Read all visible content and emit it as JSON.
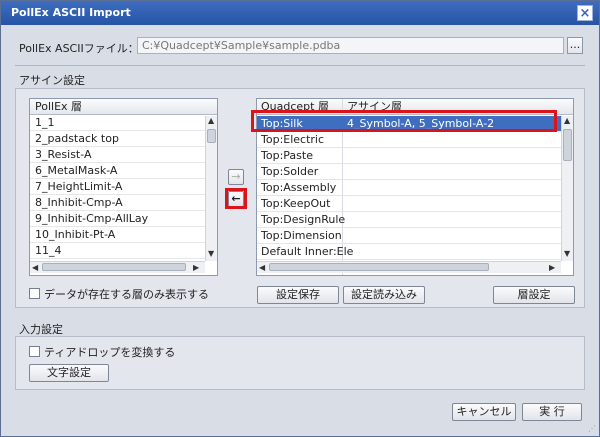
{
  "window": {
    "title": "PollEx ASCII Import"
  },
  "file": {
    "label": "PollEx ASCIIファイル：",
    "value": "C:¥Quadcept¥Sample¥sample.pdba",
    "browse": "..."
  },
  "assign": {
    "section_label": "アサイン設定",
    "pollex_header": "PollEx 層",
    "pollex_items": [
      "1_1",
      "2_padstack top",
      "3_Resist-A",
      "6_MetalMask-A",
      "7_HeightLimit-A",
      "8_Inhibit-Cmp-A",
      "9_Inhibit-Cmp-AllLay",
      "10_Inhibit-Pt-A",
      "11_4"
    ],
    "quadcept_header": "Quadcept 層",
    "assign_header": "アサイン層",
    "rows": [
      {
        "layer": "Top:Silk",
        "assign": "4_Symbol-A, 5_Symbol-A-2"
      },
      {
        "layer": "Top:Electric",
        "assign": ""
      },
      {
        "layer": "Top:Paste",
        "assign": ""
      },
      {
        "layer": "Top:Solder",
        "assign": ""
      },
      {
        "layer": "Top:Assembly",
        "assign": ""
      },
      {
        "layer": "Top:KeepOut",
        "assign": ""
      },
      {
        "layer": "Top:DesignRule",
        "assign": ""
      },
      {
        "layer": "Top:Dimension",
        "assign": ""
      },
      {
        "layer": "Default Inner:Ele",
        "assign": ""
      }
    ],
    "show_only_data": "データが存在する層のみ表示する",
    "save_btn": "設定保存",
    "load_btn": "設定読み込み",
    "layer_btn": "層設定",
    "right_arrow": "→",
    "left_arrow": "←"
  },
  "input": {
    "section_label": "入力設定",
    "teardrop": "ティアドロップを変換する",
    "text_btn": "文字設定"
  },
  "footer": {
    "cancel": "キャンセル",
    "run": "実 行"
  }
}
